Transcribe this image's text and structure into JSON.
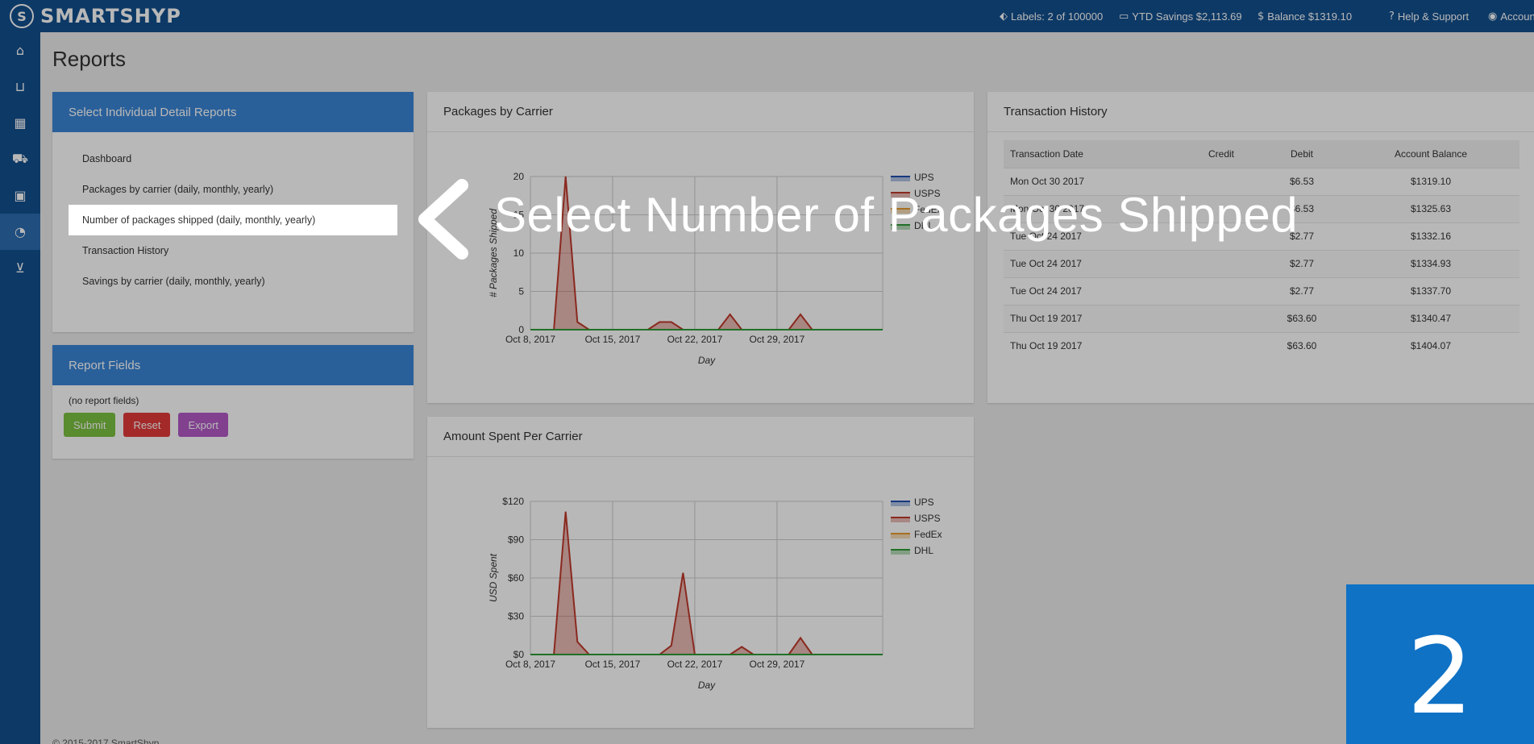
{
  "app": {
    "brand_logo": "S",
    "brand_name": "SMARTSHYP"
  },
  "topbar": {
    "labels": "Labels: 2 of 100000",
    "ytd_savings": "YTD Savings $2,113.69",
    "balance": "Balance $1319.10",
    "help": "Help & Support",
    "account": "Account",
    "icons": {
      "labels": "tag-icon",
      "savings": "money-icon",
      "balance": "dollar-icon",
      "help": "question-circle-icon",
      "account": "user-circle-icon"
    }
  },
  "sidenav": {
    "items": [
      {
        "icon": "home-icon",
        "glyph": "⌂"
      },
      {
        "icon": "basket-icon",
        "glyph": "⊔"
      },
      {
        "icon": "calendar-icon",
        "glyph": "▦"
      },
      {
        "icon": "truck-icon",
        "glyph": "⛟"
      },
      {
        "icon": "address-book-icon",
        "glyph": "▣"
      },
      {
        "icon": "pie-chart-icon",
        "glyph": "◔"
      },
      {
        "icon": "cart-icon",
        "glyph": "⊻"
      }
    ]
  },
  "page": {
    "title": "Reports",
    "footer": "© 2015-2017 SmartShyp"
  },
  "detail_reports": {
    "heading": "Select Individual Detail Reports",
    "items": [
      "Dashboard",
      "Packages by carrier (daily, monthly, yearly)",
      "Number of packages shipped (daily, monthly, yearly)",
      "Transaction History",
      "Savings by carrier (daily, monthly, yearly)"
    ],
    "selected_index": 2
  },
  "report_fields": {
    "heading": "Report Fields",
    "empty_text": "(no report fields)",
    "submit": "Submit",
    "reset": "Reset",
    "export": "Export"
  },
  "colors": {
    "topbar": "#134f8e",
    "panel_header_blue": "#3b86d6",
    "ups": "#1f4fb0",
    "usps": "#c0392b",
    "fedex": "#e69c2f",
    "dhl": "#2e9b36",
    "step_box": "#0f72c5"
  },
  "chart_data": [
    {
      "type": "area",
      "title": "Packages by Carrier",
      "xlabel": "Day",
      "ylabel": "# Packages Shipped",
      "ylim": [
        0,
        20
      ],
      "yticks": [
        "0",
        "5",
        "10",
        "15",
        "20"
      ],
      "xticks": [
        "Oct 8, 2017",
        "Oct 15, 2017",
        "Oct 22, 2017",
        "Oct 29, 2017"
      ],
      "x_days": 30,
      "legend": [
        "UPS",
        "USPS",
        "FedEx",
        "DHL"
      ],
      "legend_position": "right",
      "grid": true,
      "series": [
        {
          "name": "USPS",
          "points": [
            [
              0,
              0
            ],
            [
              2,
              0
            ],
            [
              3,
              20
            ],
            [
              4,
              1
            ],
            [
              5,
              0
            ],
            [
              10,
              0
            ],
            [
              11,
              1
            ],
            [
              12,
              1
            ],
            [
              13,
              0
            ],
            [
              16,
              0
            ],
            [
              17,
              2
            ],
            [
              18,
              0
            ],
            [
              22,
              0
            ],
            [
              23,
              2
            ],
            [
              24,
              0
            ],
            [
              30,
              0
            ]
          ]
        },
        {
          "name": "DHL",
          "points": [
            [
              0,
              0
            ],
            [
              30,
              0
            ]
          ]
        }
      ]
    },
    {
      "type": "area",
      "title": "Amount Spent Per Carrier",
      "xlabel": "Day",
      "ylabel": "USD Spent",
      "ylim": [
        0,
        120
      ],
      "yticks": [
        "$0",
        "$30",
        "$60",
        "$90",
        "$120"
      ],
      "xticks": [
        "Oct 8, 2017",
        "Oct 15, 2017",
        "Oct 22, 2017",
        "Oct 29, 2017"
      ],
      "x_days": 30,
      "legend": [
        "UPS",
        "USPS",
        "FedEx",
        "DHL"
      ],
      "legend_position": "right",
      "grid": true,
      "series": [
        {
          "name": "USPS",
          "points": [
            [
              0,
              0
            ],
            [
              2,
              0
            ],
            [
              3,
              112
            ],
            [
              4,
              10
            ],
            [
              5,
              0
            ],
            [
              11,
              0
            ],
            [
              12,
              7
            ],
            [
              13,
              64
            ],
            [
              14,
              0
            ],
            [
              17,
              0
            ],
            [
              18,
              6
            ],
            [
              19,
              0
            ],
            [
              22,
              0
            ],
            [
              23,
              13
            ],
            [
              24,
              0
            ],
            [
              30,
              0
            ]
          ]
        },
        {
          "name": "DHL",
          "points": [
            [
              0,
              0
            ],
            [
              30,
              0
            ]
          ]
        }
      ]
    }
  ],
  "transactions": {
    "heading": "Transaction History",
    "columns": [
      "Transaction Date",
      "Credit",
      "Debit",
      "Account Balance"
    ],
    "rows": [
      {
        "date": "Mon Oct 30 2017",
        "credit": "",
        "debit": "$6.53",
        "balance": "$1319.10"
      },
      {
        "date": "Mon Oct 30 2017",
        "credit": "",
        "debit": "$6.53",
        "balance": "$1325.63"
      },
      {
        "date": "Tue Oct 24 2017",
        "credit": "",
        "debit": "$2.77",
        "balance": "$1332.16"
      },
      {
        "date": "Tue Oct 24 2017",
        "credit": "",
        "debit": "$2.77",
        "balance": "$1334.93"
      },
      {
        "date": "Tue Oct 24 2017",
        "credit": "",
        "debit": "$2.77",
        "balance": "$1337.70"
      },
      {
        "date": "Thu Oct 19 2017",
        "credit": "",
        "debit": "$63.60",
        "balance": "$1340.47"
      },
      {
        "date": "Thu Oct 19 2017",
        "credit": "",
        "debit": "$63.60",
        "balance": "$1404.07"
      }
    ]
  },
  "tutorial": {
    "caption": "Select Number of Packages Shipped",
    "step": "2",
    "arrow_icon": "chevron-left-icon"
  }
}
